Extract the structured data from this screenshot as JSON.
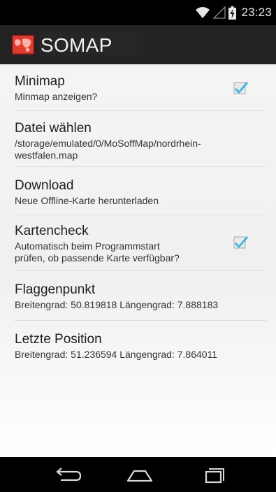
{
  "status_bar": {
    "time": "23:23",
    "icons": [
      "wifi-icon",
      "signal-icon",
      "battery-charging-icon"
    ]
  },
  "action_bar": {
    "title": "SOMAP",
    "app_icon": "map-app-icon"
  },
  "preferences": [
    {
      "title": "Minimap",
      "summary": "Minmap anzeigen?",
      "has_checkbox": true,
      "checked": true
    },
    {
      "title": "Datei wählen",
      "summary_lines": [
        "/storage/emulated/0/MoSoffMap/nordrhein-",
        "westfalen.map"
      ],
      "has_checkbox": false
    },
    {
      "title": "Download",
      "summary": "Neue Offline-Karte herunterladen",
      "has_checkbox": false
    },
    {
      "title": "Kartencheck",
      "summary_lines": [
        "Automatisch beim Programmstart",
        "prüfen, ob passende Karte verfügbar?"
      ],
      "has_checkbox": true,
      "checked": true
    },
    {
      "title": "Flaggenpunkt",
      "summary": "Breitengrad: 50.819818 Längengrad: 7.888183",
      "has_checkbox": false
    },
    {
      "title": "Letzte Position",
      "summary": "Breitengrad: 51.236594 Längengrad: 7.864011",
      "has_checkbox": false
    }
  ],
  "nav_bar": {
    "buttons": [
      "back-icon",
      "home-icon",
      "recent-apps-icon"
    ]
  },
  "colors": {
    "accent": "#33b5e5",
    "action_bar": "#222222",
    "background": "#f2f2f2"
  }
}
